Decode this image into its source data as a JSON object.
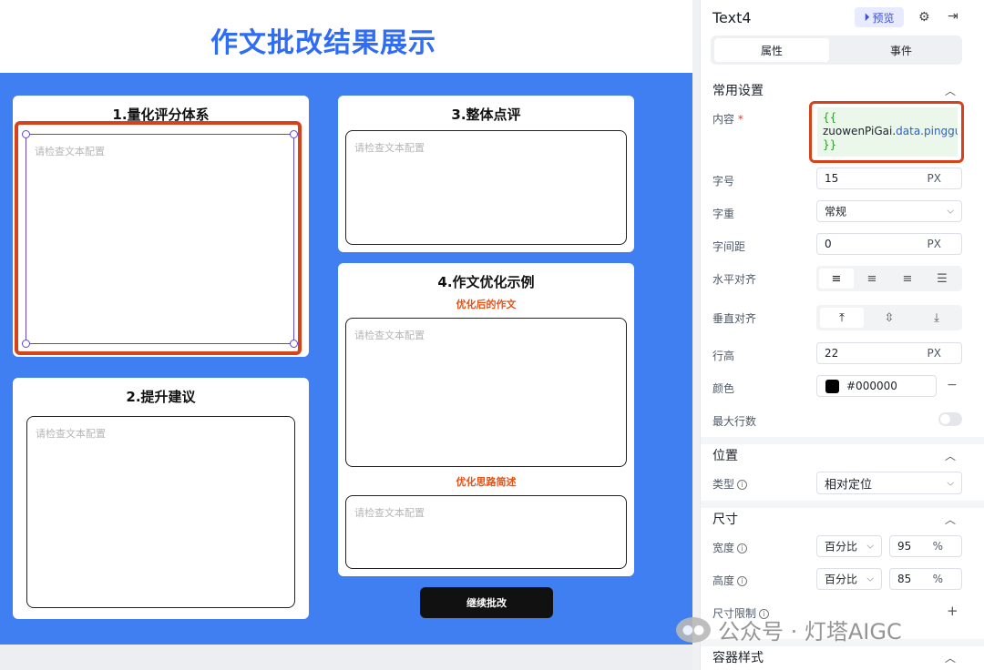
{
  "canvas": {
    "page_title": "作文批改结果展示",
    "cards": {
      "quant": {
        "title": "1.量化评分体系",
        "placeholder": "请检查文本配置"
      },
      "advice": {
        "title": "2.提升建议",
        "placeholder": "请检查文本配置"
      },
      "overall": {
        "title": "3.整体点评",
        "placeholder": "请检查文本配置"
      },
      "example": {
        "title": "4.作文优化示例",
        "sub1": "优化后的作文",
        "placeholder1": "请检查文本配置",
        "sub2": "优化思路简述",
        "placeholder2": "请检查文本配置"
      }
    },
    "continue_button": "继续批改"
  },
  "panel": {
    "component_name": "Text4",
    "preview_label": "预览",
    "tabs": [
      "属性",
      "事件"
    ],
    "sections": {
      "common": "常用设置",
      "position": "位置",
      "size": "尺寸",
      "container": "容器样式"
    },
    "fields": {
      "content_label": "内容",
      "content_open": "{{",
      "content_ident": "zuowenPiGai.",
      "content_path": "data.pinggu",
      "content_close": "}}",
      "font_size_label": "字号",
      "font_size_value": "15",
      "font_size_unit": "PX",
      "font_weight_label": "字重",
      "font_weight_value": "常规",
      "letter_spacing_label": "字间距",
      "letter_spacing_value": "0",
      "letter_spacing_unit": "PX",
      "h_align_label": "水平对齐",
      "v_align_label": "垂直对齐",
      "line_height_label": "行高",
      "line_height_value": "22",
      "line_height_unit": "PX",
      "color_label": "颜色",
      "color_value": "#000000",
      "max_lines_label": "最大行数",
      "type_label": "类型",
      "type_value": "相对定位",
      "width_label": "宽度",
      "width_mode": "百分比",
      "width_value": "95",
      "height_label": "高度",
      "height_mode": "百分比",
      "height_value": "85",
      "percent_unit": "%",
      "size_limit_label": "尺寸限制"
    },
    "colors": {
      "accent": "#2f6df6",
      "canvas_bg": "#3f7ff2",
      "selection": "#d8421a"
    }
  },
  "watermark": {
    "text": "公众号 · 灯塔AIGC"
  }
}
